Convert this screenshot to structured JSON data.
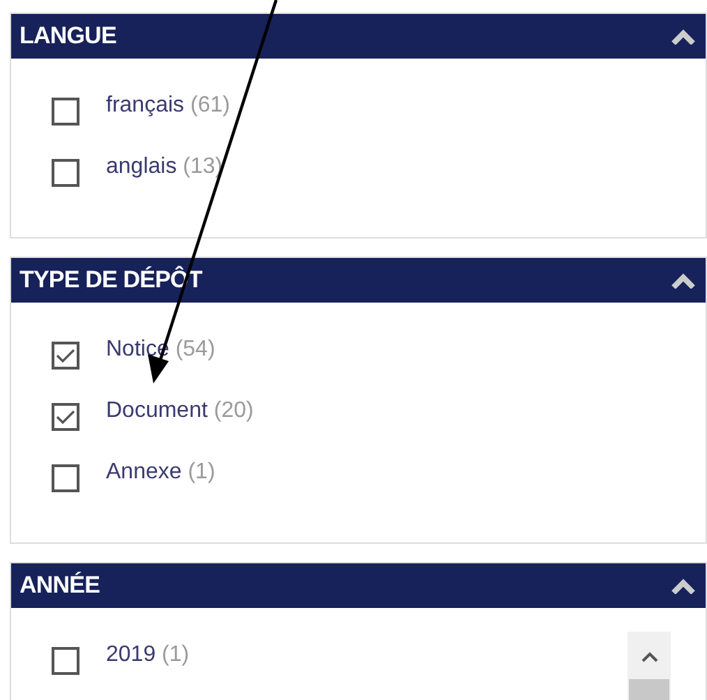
{
  "panels": [
    {
      "title": "LANGUE",
      "expanded": true,
      "scrollable": false,
      "items": [
        {
          "label": "français",
          "count": "(61)",
          "checked": false
        },
        {
          "label": "anglais",
          "count": "(13)",
          "checked": false
        }
      ]
    },
    {
      "title": "TYPE DE DÉPÔT",
      "expanded": true,
      "scrollable": false,
      "items": [
        {
          "label": "Notice",
          "count": "(54)",
          "checked": true
        },
        {
          "label": "Document",
          "count": "(20)",
          "checked": true
        },
        {
          "label": "Annexe",
          "count": "(1)",
          "checked": false
        }
      ]
    },
    {
      "title": "ANNÉE",
      "expanded": true,
      "scrollable": true,
      "items": [
        {
          "label": "2019",
          "count": "(1)",
          "checked": false
        }
      ]
    }
  ]
}
